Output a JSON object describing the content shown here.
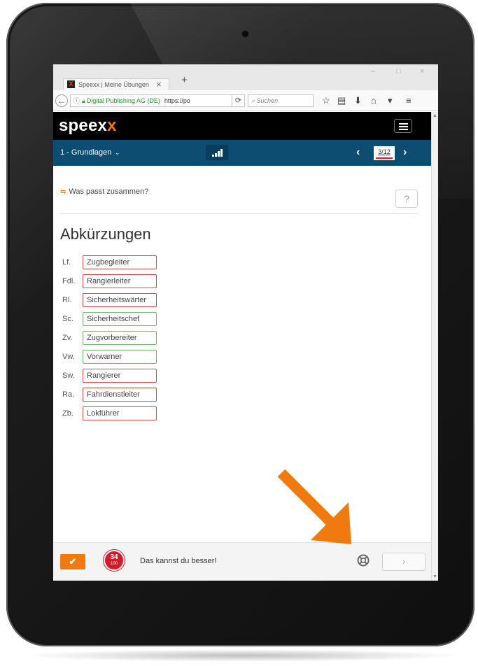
{
  "browser": {
    "tab_title": "Speexx | Meine Übungen",
    "tab_close": "×",
    "new_tab": "+",
    "window_controls": [
      "–",
      "□",
      "×"
    ],
    "site_identity": "Digital Publishing AG (DE)",
    "url": "https://po",
    "search_placeholder": "Suchen",
    "toolbar_icons": [
      "star-icon",
      "reading-list-icon",
      "download-icon",
      "home-icon",
      "pocket-icon",
      "menu-icon"
    ]
  },
  "app": {
    "logo_main": "speex",
    "logo_accent": "x",
    "accent_color": "#f07a10",
    "header_color": "#000000",
    "bar_color": "#0e4d72",
    "lesson": "1 - Grundlagen",
    "page_indicator": "3/12"
  },
  "exercise": {
    "instruction": "Was passt zusammen?",
    "help_label": "?",
    "heading": "Abkürzungen",
    "rows": [
      {
        "abbr": "Lf.",
        "answer": "Zugbegleiter",
        "correct": false
      },
      {
        "abbr": "Fdl.",
        "answer": "Rangierleiter",
        "correct": false
      },
      {
        "abbr": "Rl.",
        "answer": "Sicherheitswärter",
        "correct": false
      },
      {
        "abbr": "Sc.",
        "answer": "Sicherheitschef",
        "correct": true
      },
      {
        "abbr": "Zv.",
        "answer": "Zugvorbereiter",
        "correct": true
      },
      {
        "abbr": "Vw.",
        "answer": "Vorwarner",
        "correct": true
      },
      {
        "abbr": "Sw.",
        "answer": "Rangierer",
        "correct": false
      },
      {
        "abbr": "Ra.",
        "answer": "Fahrdienstleiter",
        "correct": false
      },
      {
        "abbr": "Zb.",
        "answer": "Lokführer",
        "correct": false
      }
    ]
  },
  "footer": {
    "check_label": "✔",
    "score_value": "34",
    "score_max": "100",
    "score_message": "Das kannst du besser!",
    "next_label": "›",
    "correct_color": "#6ab86a",
    "wrong_color": "#d94848"
  }
}
